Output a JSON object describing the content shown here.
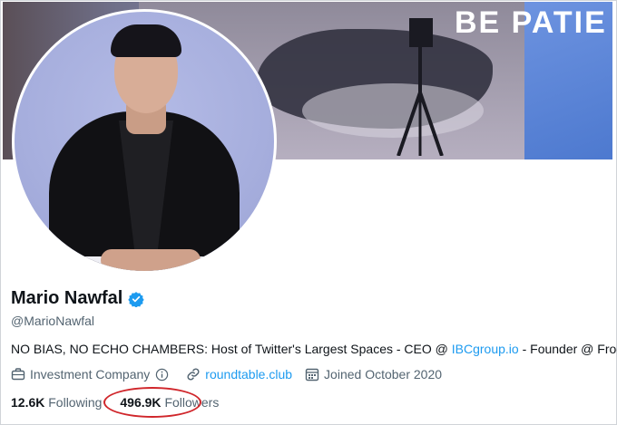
{
  "banner": {
    "text_bold": "BE PATIE",
    "accent": "#4d79cf"
  },
  "profile": {
    "name": "Mario Nawfal",
    "handle": "@MarioNawfal",
    "verified_icon": "verified-badge-icon",
    "bio_prefix": "NO BIAS, NO ECHO CHAMBERS: Host of Twitter's Largest Spaces - CEO @ ",
    "bio_link": "IBCgroup.io",
    "bio_suffix": " - Founder @ Froothie",
    "category": "Investment Company",
    "website": "roundtable.club",
    "joined": "Joined October 2020"
  },
  "stats": {
    "following_count": "12.6K",
    "following_label": "Following",
    "followers_count": "496.9K",
    "followers_label": "Followers"
  },
  "colors": {
    "link": "#1d9bf0",
    "secondary_text": "#536471",
    "annotation": "#d0262b"
  }
}
